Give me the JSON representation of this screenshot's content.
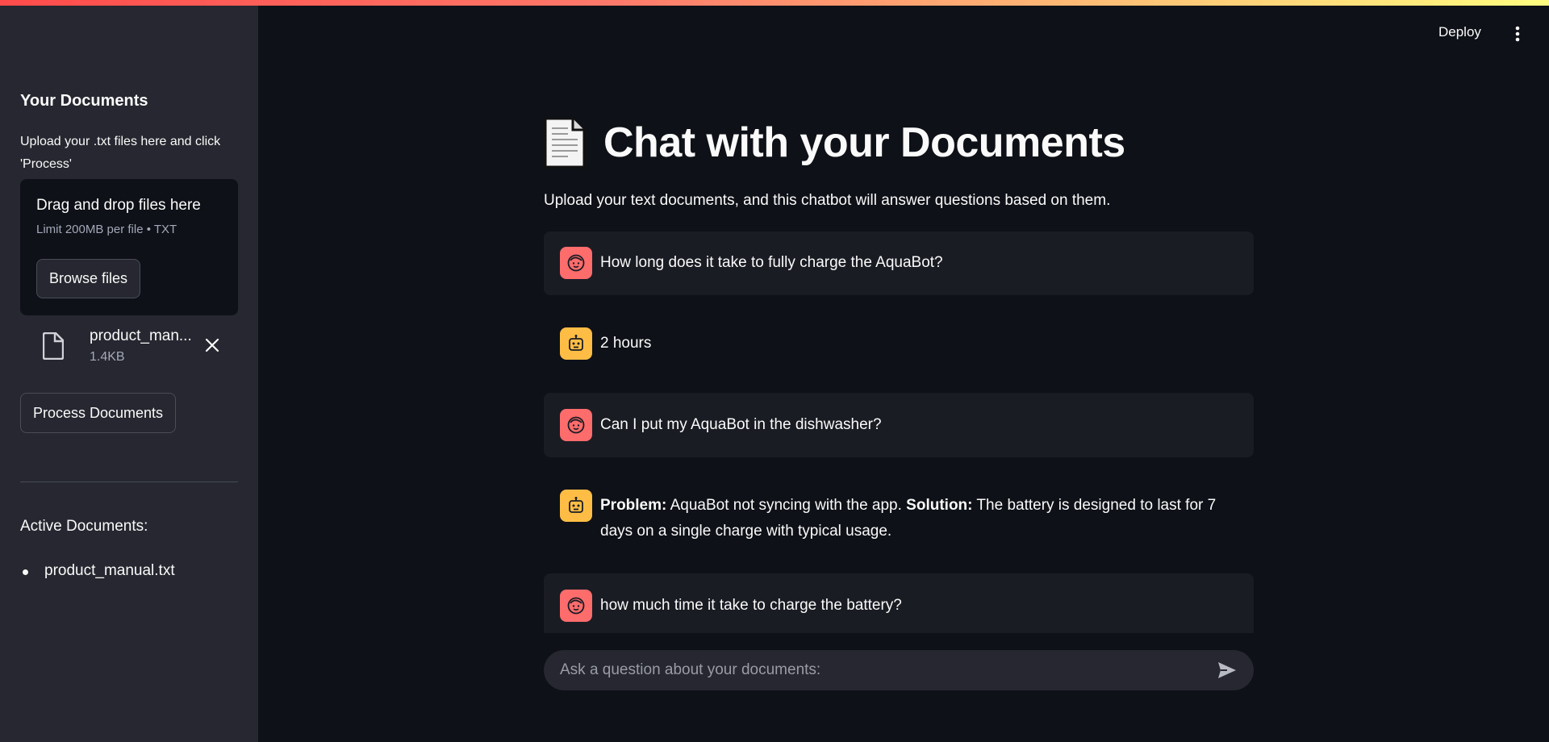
{
  "sidebar": {
    "title": "Your Documents",
    "help_text": "Upload your .txt files here and click 'Process'",
    "dropzone": {
      "title": "Drag and drop files here",
      "limit": "Limit 200MB per file • TXT",
      "browse_label": "Browse files"
    },
    "uploaded_file": {
      "name": "product_manual.txt",
      "display_name": "product_man...",
      "size": "1.4KB",
      "icon": "file-icon",
      "remove_icon": "close-icon"
    },
    "process_label": "Process Documents",
    "active_title": "Active Documents:",
    "active_docs": [
      "product_manual.txt"
    ]
  },
  "header": {
    "deploy_label": "Deploy",
    "menu_icon": "more-vert-icon"
  },
  "main": {
    "title_emoji": "page-facing-up-icon",
    "title": "Chat with your Documents",
    "subtitle": "Upload your text documents, and this chatbot will answer questions based on them.",
    "messages": [
      {
        "role": "user",
        "text": "How long does it take to fully charge the AquaBot?"
      },
      {
        "role": "assistant",
        "text": "2 hours"
      },
      {
        "role": "user",
        "text": "Can I put my AquaBot in the dishwasher?"
      },
      {
        "role": "assistant",
        "problem_label": "Problem:",
        "problem_text": " AquaBot not syncing with the app. ",
        "solution_label": "Solution:",
        "solution_text": " The battery is designed to last for 7 days on a single charge with typical usage."
      },
      {
        "role": "user",
        "text": "how much time it take to charge the battery?"
      }
    ],
    "input_placeholder": "Ask a question about your documents:",
    "send_icon": "send-icon"
  },
  "colors": {
    "background": "#0e1117",
    "sidebar": "#262730",
    "user_avatar": "#ff6c6c",
    "bot_avatar": "#ffbd45",
    "accent_gradient_start": "#ff4b4b",
    "accent_gradient_end": "#fffd80"
  }
}
